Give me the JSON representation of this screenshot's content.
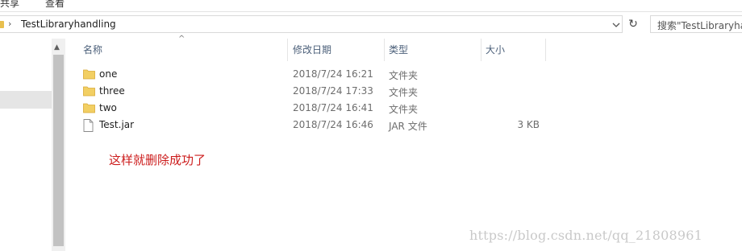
{
  "ribbon": {
    "tab_share": "共享",
    "tab_view": "查看"
  },
  "address_bar": {
    "path": "TestLibraryhandling"
  },
  "search": {
    "placeholder": "搜索\"TestLibraryha"
  },
  "columns": {
    "name": "名称",
    "date_modified": "修改日期",
    "type": "类型",
    "size": "大小"
  },
  "files": [
    {
      "name": "one",
      "date": "2018/7/24 16:21",
      "type": "文件夹",
      "size": "",
      "icon": "folder-icon"
    },
    {
      "name": "three",
      "date": "2018/7/24 17:33",
      "type": "文件夹",
      "size": "",
      "icon": "folder-icon"
    },
    {
      "name": "two",
      "date": "2018/7/24 16:41",
      "type": "文件夹",
      "size": "",
      "icon": "folder-icon"
    },
    {
      "name": "Test.jar",
      "date": "2018/7/24 16:46",
      "type": "JAR 文件",
      "size": "3 KB",
      "icon": "file-icon"
    }
  ],
  "annotation": "这样就删除成功了",
  "watermark": "https://blog.csdn.net/qq_21808961",
  "colors": {
    "folder": "#e8bf4e",
    "annotation": "#cc1c1c",
    "header_text": "#4c607a"
  }
}
